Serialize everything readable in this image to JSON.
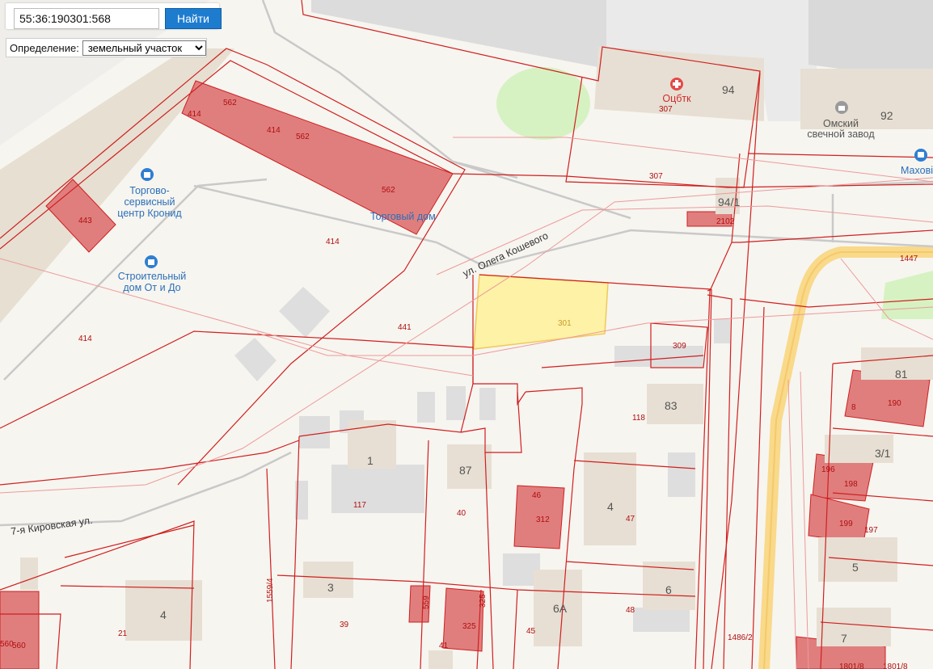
{
  "search": {
    "value": "55:36:190301:568",
    "button_label": "Найти"
  },
  "definition": {
    "label": "Определение:",
    "selected": "земельный участок"
  },
  "colors": {
    "selected_parcel": "#fdf2a6",
    "parcel_fill": "#e07e7e",
    "parcel_border": "#d01f1f",
    "road_yellow": "#f9d98a"
  },
  "streets": {
    "olega_koshevogo": "ул. Олега Кошевого",
    "kirovskaya": "7-я Кировская ул."
  },
  "pois": {
    "kronid": [
      "Торгово-",
      "сервисный",
      "центр Кронид"
    ],
    "ot_i_do": [
      "Строительный",
      "дом От и До"
    ],
    "torg_dom": "Торговый дом",
    "ocbtk": "Оцбтк",
    "candle": [
      "Омский",
      "свечной завод"
    ],
    "mahov": "Махові"
  },
  "parcels": {
    "p562a": "562",
    "p414a": "414",
    "p414b": "414",
    "p562b": "562",
    "p562c": "562",
    "p443": "443",
    "p414c": "414",
    "p414d": "414",
    "p441": "441",
    "p301": "301",
    "p307a": "307",
    "p307b": "307",
    "p2102": "2102",
    "p1447": "1447",
    "p309": "309",
    "p118": "118",
    "p190": "190",
    "p8": "8",
    "p196": "196",
    "p198": "198",
    "p199": "199",
    "p197": "197",
    "p117": "117",
    "p40": "40",
    "p46": "46",
    "p312": "312",
    "p47": "47",
    "p1559": "1559/4",
    "p559": "559",
    "p325a": "325",
    "p325b": "325",
    "p39": "39",
    "p41": "41",
    "p45": "45",
    "p48": "48",
    "p21": "21",
    "p560a": "560",
    "p560b": "560",
    "p1486": "1486/2",
    "p1801": "1801/8",
    "p1801b": "1801/8"
  },
  "houses": {
    "h94": "94",
    "h92": "92",
    "h94_1": "94/1",
    "h81": "81",
    "h83": "83",
    "h1": "1",
    "h87": "87",
    "h3_1": "3/1",
    "h4a": "4",
    "h5": "5",
    "h3": "3",
    "h6": "6",
    "h6a": "6А",
    "h4b": "4",
    "h7": "7"
  },
  "icons": [
    "shopping-bag-icon",
    "medical-cross-icon",
    "factory-icon",
    "bus-stop-icon"
  ]
}
